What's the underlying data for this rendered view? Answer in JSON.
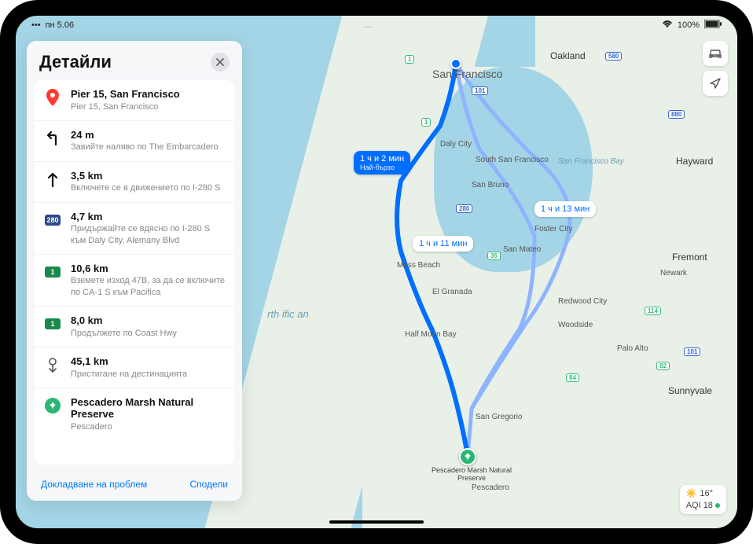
{
  "status_bar": {
    "time": "пн 5.06",
    "center": "",
    "battery": "100%"
  },
  "panel": {
    "title": "Детайли",
    "report_label": "Докладване на проблем",
    "share_label": "Сподели"
  },
  "steps": [
    {
      "icon": "pin-start",
      "primary": "Pier 15, San Francisco",
      "secondary": "Pier 15, San Francisco"
    },
    {
      "icon": "turn-left",
      "primary": "24 m",
      "secondary": "Завийте наляво по The Embarcadero"
    },
    {
      "icon": "straight",
      "primary": "3,5 km",
      "secondary": "Включете се в движението по I-280 S"
    },
    {
      "icon": "interstate-280",
      "primary": "4,7 km",
      "secondary": "Придържайте се вдясно по I-280 S към Daly City, Alemany Blvd"
    },
    {
      "icon": "ca-1",
      "primary": "10,6 km",
      "secondary": "Вземете изход 47B, за да се включите по CA-1 S към Pacifica"
    },
    {
      "icon": "ca-1",
      "primary": "8,0 km",
      "secondary": "Продължете по Coast Hwy"
    },
    {
      "icon": "arrive",
      "primary": "45,1 km",
      "secondary": "Пристигане на дестинацията"
    },
    {
      "icon": "pin-end",
      "primary": "Pescadero Marsh Natural Preserve",
      "secondary": "Pescadero"
    }
  ],
  "routes": {
    "primary_callout": {
      "time": "1 ч и 2 мин",
      "label": "Най-бързо"
    },
    "alt1_callout": "1 ч и 11 мин",
    "alt2_callout": "1 ч и 13 мин"
  },
  "map_labels": {
    "san_francisco": "San Francisco",
    "oakland": "Oakland",
    "daly_city": "Daly City",
    "south_sf": "South San Francisco",
    "san_bruno": "San Bruno",
    "hayward": "Hayward",
    "san_mateo": "San Mateo",
    "foster_city": "Foster City",
    "redwood_city": "Redwood City",
    "fremont": "Fremont",
    "newark": "Newark",
    "palo_alto": "Palo Alto",
    "sunnyvale": "Sunnyvale",
    "half_moon_bay": "Half Moon Bay",
    "moss_beach": "Moss Beach",
    "el_granada": "El Granada",
    "woodside": "Woodside",
    "san_gregorio": "San Gregorio",
    "pescadero": "Pescadero",
    "sf_bay": "San Francisco Bay",
    "pacific": "rth ific an",
    "dest_name": "Pescadero Marsh Natural Preserve"
  },
  "weather": {
    "temp": "16°",
    "aqi": "AQI 18"
  },
  "colors": {
    "accent": "#007aff",
    "route_primary": "#006fff",
    "route_alt": "#7aa7ff",
    "green": "#2bb673"
  }
}
